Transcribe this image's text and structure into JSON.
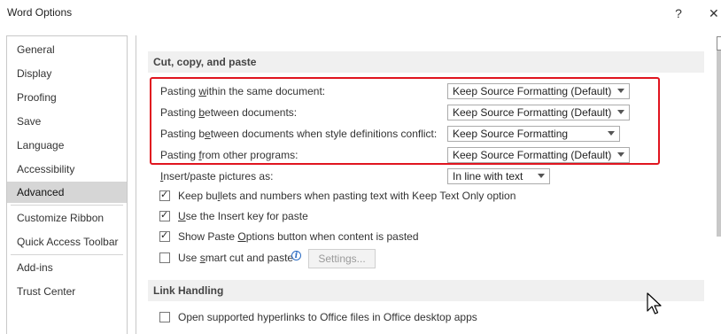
{
  "window": {
    "title": "Word Options",
    "help_glyph": "?",
    "close_glyph": "✕"
  },
  "nav": {
    "items": [
      {
        "label": "General"
      },
      {
        "label": "Display"
      },
      {
        "label": "Proofing"
      },
      {
        "label": "Save"
      },
      {
        "label": "Language"
      },
      {
        "label": "Accessibility"
      },
      {
        "label": "Advanced"
      },
      {
        "label": "Customize Ribbon"
      },
      {
        "label": "Quick Access Toolbar"
      },
      {
        "label": "Add-ins"
      },
      {
        "label": "Trust Center"
      }
    ],
    "selected": "Advanced"
  },
  "cut_copy_paste": {
    "heading": "Cut, copy, and paste",
    "rows": [
      {
        "label_pre": "Pasting ",
        "label_u": "w",
        "label_post": "ithin the same document:",
        "value": "Keep Source Formatting (Default)"
      },
      {
        "label_pre": "Pasting ",
        "label_u": "b",
        "label_post": "etween documents:",
        "value": "Keep Source Formatting (Default)"
      },
      {
        "label_pre": "Pasting b",
        "label_u": "e",
        "label_post": "tween documents when style definitions conflict:",
        "value": "Keep Source Formatting"
      },
      {
        "label_pre": "Pasting ",
        "label_u": "f",
        "label_post": "rom other programs:",
        "value": "Keep Source Formatting (Default)"
      }
    ],
    "insert_pictures": {
      "label_pre": "",
      "label_u": "I",
      "label_post": "nsert/paste pictures as:",
      "value": "In line with text"
    },
    "checkboxes": [
      {
        "label_pre": "Keep bu",
        "label_u": "l",
        "label_post": "lets and numbers when pasting text with Keep Text Only option",
        "checked": true
      },
      {
        "label_pre": "",
        "label_u": "U",
        "label_post": "se the Insert key for paste",
        "checked": true
      },
      {
        "label_pre": "Show Paste ",
        "label_u": "O",
        "label_post": "ptions button when content is pasted",
        "checked": true
      },
      {
        "label_pre": "Use ",
        "label_u": "s",
        "label_post": "mart cut and paste",
        "checked": false
      }
    ],
    "settings_button": "Settings..."
  },
  "link_handling": {
    "heading": "Link Handling",
    "checkboxes": [
      {
        "label": "Open supported hyperlinks to Office files in Office desktop apps",
        "checked": false
      }
    ]
  },
  "check_glyph": "✓",
  "info_glyph": "i",
  "colors": {
    "highlight_border": "#e0151f",
    "nav_selected_bg": "#d6d6d6",
    "section_bg": "#f0f0f0"
  }
}
